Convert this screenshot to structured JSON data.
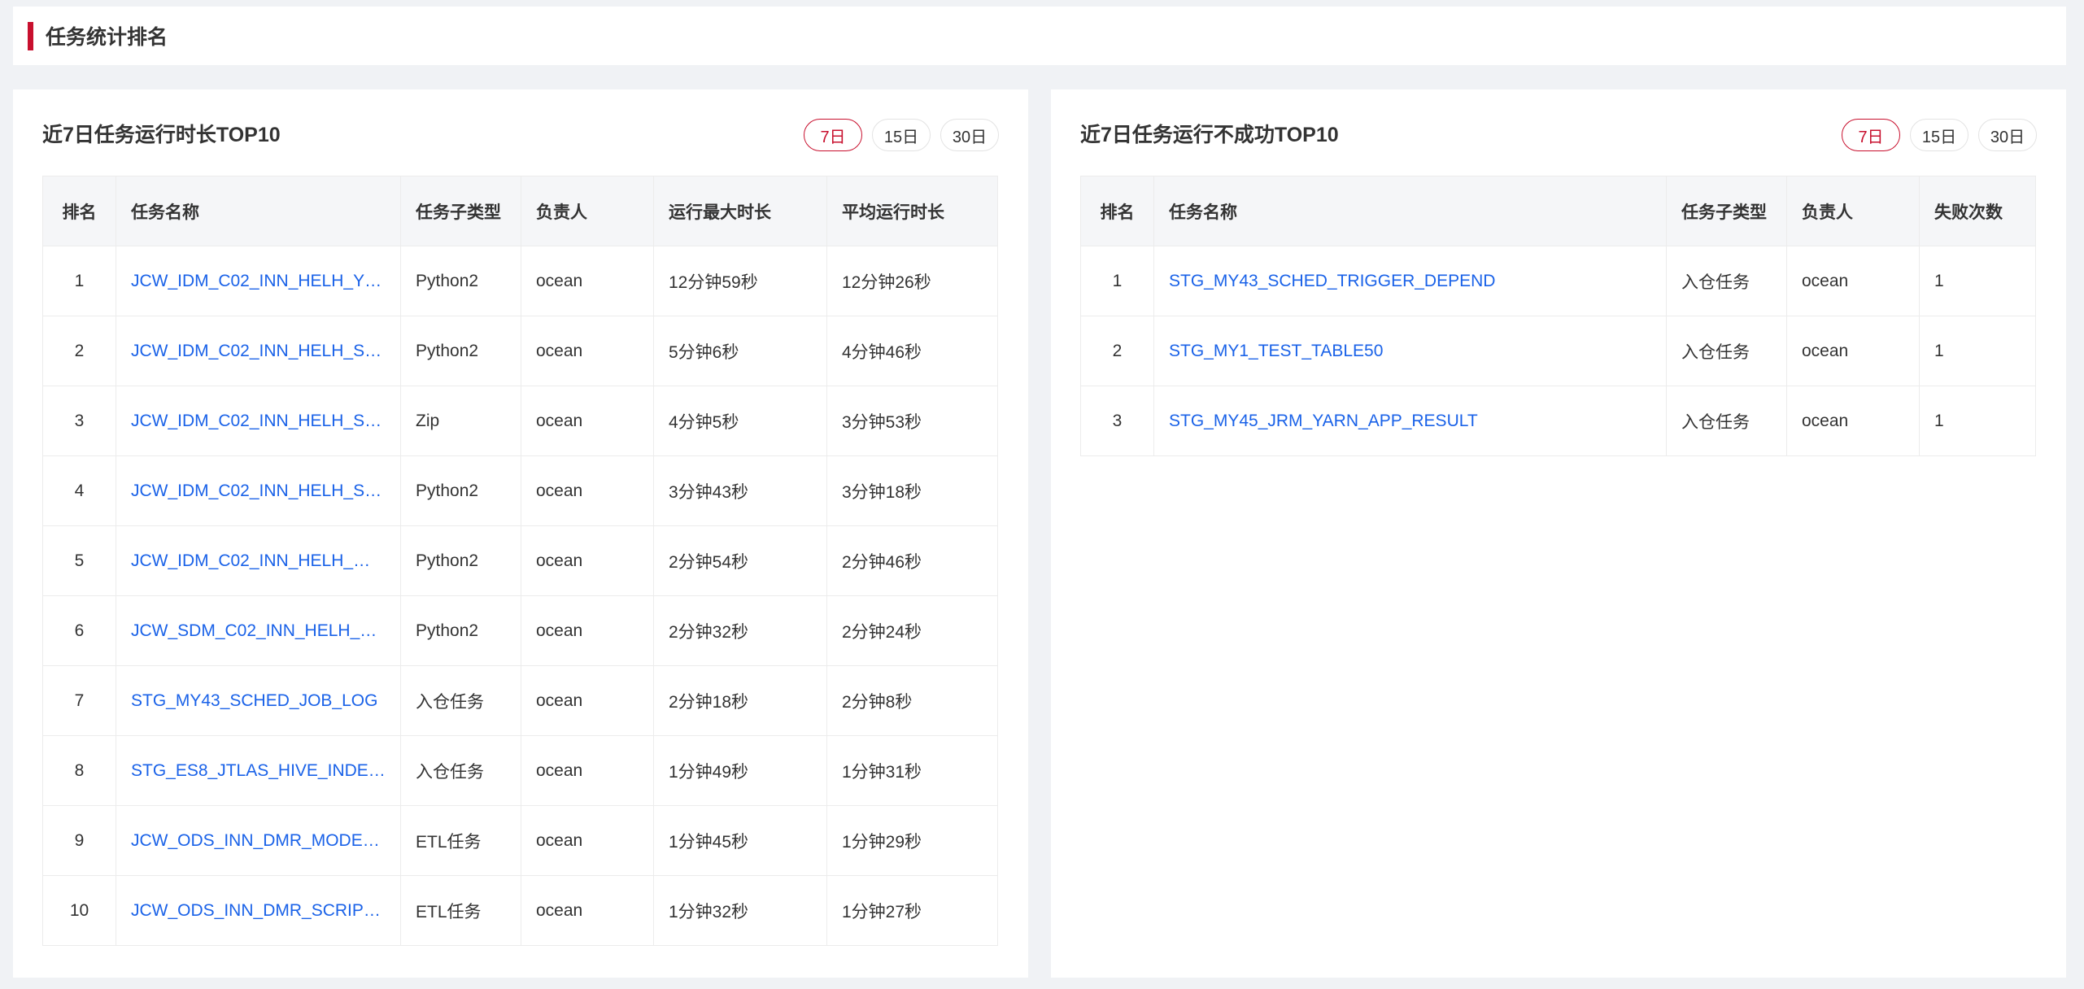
{
  "section": {
    "title": "任务统计排名"
  },
  "left_panel": {
    "title": "近7日任务运行时长TOP10",
    "ranges": [
      "7日",
      "15日",
      "30日"
    ],
    "active_range": "7日",
    "columns": [
      "排名",
      "任务名称",
      "任务子类型",
      "负责人",
      "运行最大时长",
      "平均运行时长"
    ],
    "rows": [
      [
        "1",
        "JCW_IDM_C02_INN_HELH_Y…",
        "Python2",
        "ocean",
        "12分钟59秒",
        "12分钟26秒"
      ],
      [
        "2",
        "JCW_IDM_C02_INN_HELH_S…",
        "Python2",
        "ocean",
        "5分钟6秒",
        "4分钟46秒"
      ],
      [
        "3",
        "JCW_IDM_C02_INN_HELH_S…",
        "Zip",
        "ocean",
        "4分钟5秒",
        "3分钟53秒"
      ],
      [
        "4",
        "JCW_IDM_C02_INN_HELH_S…",
        "Python2",
        "ocean",
        "3分钟43秒",
        "3分钟18秒"
      ],
      [
        "5",
        "JCW_IDM_C02_INN_HELH_…",
        "Python2",
        "ocean",
        "2分钟54秒",
        "2分钟46秒"
      ],
      [
        "6",
        "JCW_SDM_C02_INN_HELH_…",
        "Python2",
        "ocean",
        "2分钟32秒",
        "2分钟24秒"
      ],
      [
        "7",
        "STG_MY43_SCHED_JOB_LOG",
        "入仓任务",
        "ocean",
        "2分钟18秒",
        "2分钟8秒"
      ],
      [
        "8",
        "STG_ES8_JTLAS_HIVE_INDE…",
        "入仓任务",
        "ocean",
        "1分钟49秒",
        "1分钟31秒"
      ],
      [
        "9",
        "JCW_ODS_INN_DMR_MODE…",
        "ETL任务",
        "ocean",
        "1分钟45秒",
        "1分钟29秒"
      ],
      [
        "10",
        "JCW_ODS_INN_DMR_SCRIP…",
        "ETL任务",
        "ocean",
        "1分钟32秒",
        "1分钟27秒"
      ]
    ]
  },
  "right_panel": {
    "title": "近7日任务运行不成功TOP10",
    "ranges": [
      "7日",
      "15日",
      "30日"
    ],
    "active_range": "7日",
    "columns": [
      "排名",
      "任务名称",
      "任务子类型",
      "负责人",
      "失败次数"
    ],
    "rows": [
      [
        "1",
        "STG_MY43_SCHED_TRIGGER_DEPEND",
        "入仓任务",
        "ocean",
        "1"
      ],
      [
        "2",
        "STG_MY1_TEST_TABLE50",
        "入仓任务",
        "ocean",
        "1"
      ],
      [
        "3",
        "STG_MY45_JRM_YARN_APP_RESULT",
        "入仓任务",
        "ocean",
        "1"
      ]
    ]
  },
  "colors": {
    "accent": "#c8102e",
    "link": "#1a62e8",
    "header_bg": "#f5f6f8"
  }
}
